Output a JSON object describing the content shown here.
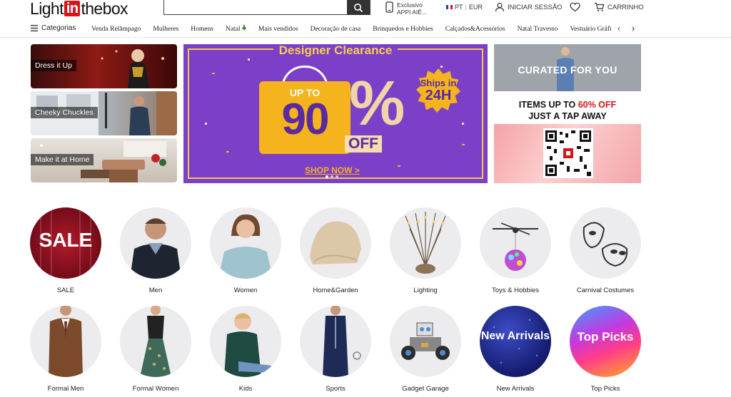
{
  "header": {
    "logo_left": "Light",
    "logo_in": "in",
    "logo_right": "thebox",
    "search": {
      "value": "",
      "placeholder": ""
    },
    "app_promo": "Exclusivo APPI AIÊ...",
    "language": "PT",
    "currency": "EUR",
    "login_label": "INICIAR SESSÃO",
    "cart_label": "CARRINHO"
  },
  "nav": {
    "categories_label": "Categorias",
    "items": [
      "Venda Relâmpago",
      "Mulheres",
      "Homens",
      "Natal",
      "Mais vendidos",
      "Decoração de casa",
      "Brinquedos e Hobbies",
      "Calçados&Acessórios",
      "Natal Travesso",
      "Vestuário Gráfi"
    ]
  },
  "banners": {
    "left": [
      {
        "caption": "Dress it Up"
      },
      {
        "caption": "Cheeky Chuckles"
      },
      {
        "caption": "Make it at Home"
      }
    ],
    "main": {
      "title": "Designer Clearance",
      "up_to": "UP TO",
      "amount": "90",
      "percent": "%",
      "off": "OFF",
      "ships_line1": "Ships in",
      "ships_line2": "24H",
      "cta": "SHOP NOW >"
    },
    "right": {
      "curated": "CURATED FOR YOU",
      "items_line1_prefix": "ITEMS UP TO ",
      "items_line1_highlight": "60% OFF",
      "items_line2": "JUST A TAP AWAY"
    }
  },
  "categories": [
    {
      "label": "SALE",
      "word": "SALE"
    },
    {
      "label": "Men"
    },
    {
      "label": "Women"
    },
    {
      "label": "Home&Garden"
    },
    {
      "label": "Lighting"
    },
    {
      "label": "Toys & Hobbies"
    },
    {
      "label": "Carnival Costumes"
    },
    {
      "label": "Formal Men"
    },
    {
      "label": "Formal Women"
    },
    {
      "label": "Kids"
    },
    {
      "label": "Sports"
    },
    {
      "label": "Gadget Garage"
    },
    {
      "label": "New Arrivals",
      "word": "New Arrivals"
    },
    {
      "label": "Top Picks",
      "word": "Top Picks"
    }
  ],
  "colors": {
    "brand_red": "#d7141a",
    "clearance_purple": "#7b3fc8",
    "clearance_gold": "#f5b31d"
  }
}
